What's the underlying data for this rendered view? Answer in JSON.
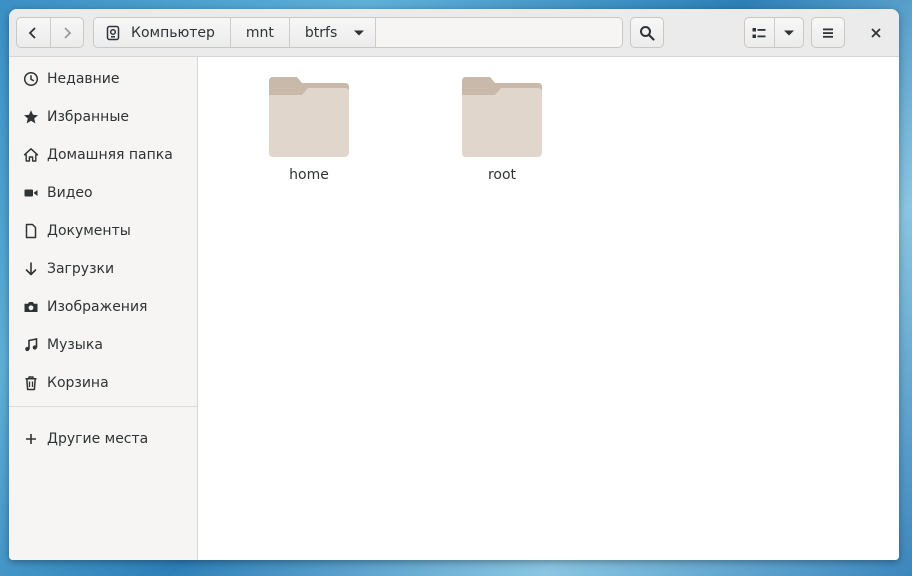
{
  "headerbar": {
    "path": [
      "Компьютер",
      "mnt",
      "btrfs"
    ]
  },
  "sidebar": {
    "items": [
      {
        "label": "Недавние",
        "icon": "clock-icon"
      },
      {
        "label": "Избранные",
        "icon": "star-icon"
      },
      {
        "label": "Домашняя папка",
        "icon": "home-icon"
      },
      {
        "label": "Видео",
        "icon": "video-icon"
      },
      {
        "label": "Документы",
        "icon": "document-icon"
      },
      {
        "label": "Загрузки",
        "icon": "download-icon"
      },
      {
        "label": "Изображения",
        "icon": "camera-icon"
      },
      {
        "label": "Музыка",
        "icon": "music-icon"
      },
      {
        "label": "Корзина",
        "icon": "trash-icon"
      }
    ],
    "other_places": "Другие места"
  },
  "files": [
    {
      "name": "home",
      "type": "folder"
    },
    {
      "name": "root",
      "type": "folder"
    }
  ],
  "colors": {
    "folder_back": "#c9b9aa",
    "folder_front": "#e0d6cc",
    "text": "#2e3436"
  }
}
